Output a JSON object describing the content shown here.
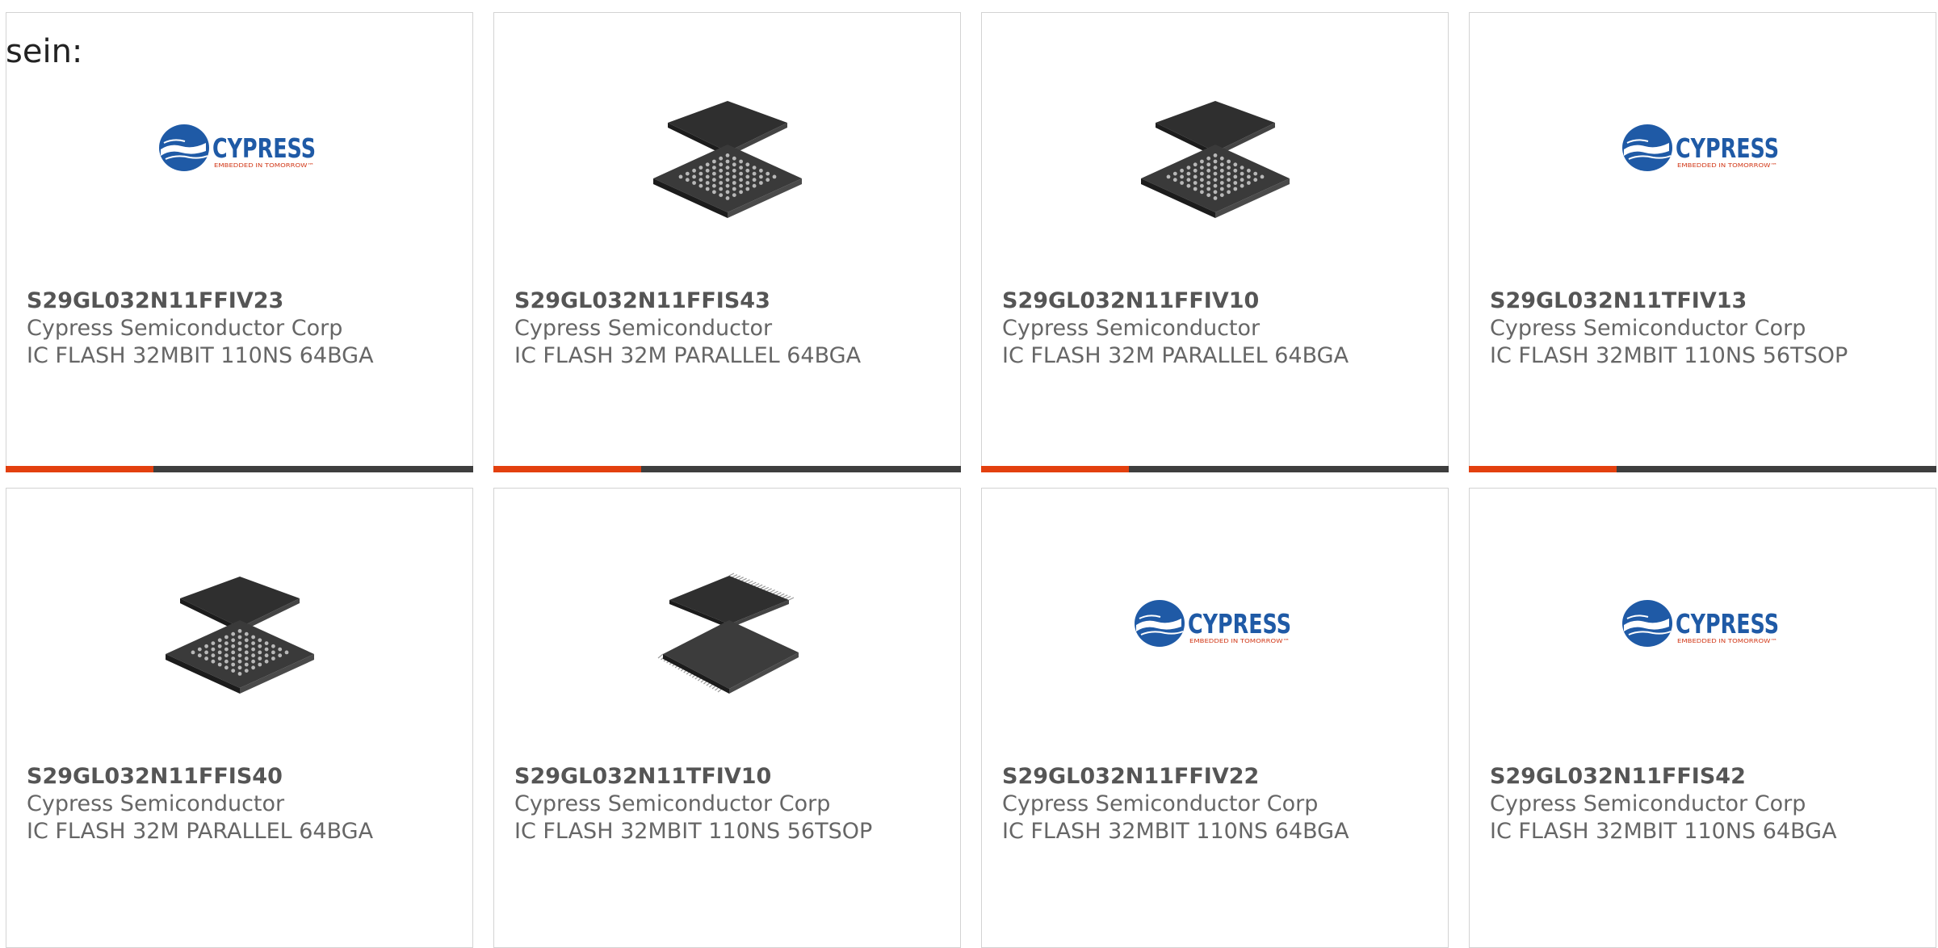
{
  "intro_text": "sein:",
  "colors": {
    "accent": "#e3400f",
    "bar": "#3e3e3e",
    "cypress_blue": "#1f5aa6"
  },
  "products": [
    {
      "part_number": "S29GL032N11FFIV23",
      "manufacturer": "Cypress Semiconductor Corp",
      "description": "IC FLASH 32MBIT 110NS 64BGA",
      "image": "cypress-logo",
      "has_bar": true
    },
    {
      "part_number": "S29GL032N11FFIS43",
      "manufacturer": "Cypress Semiconductor",
      "description": "IC FLASH 32M PARALLEL 64BGA",
      "image": "bga-chip",
      "has_bar": true
    },
    {
      "part_number": "S29GL032N11FFIV10",
      "manufacturer": "Cypress Semiconductor",
      "description": "IC FLASH 32M PARALLEL 64BGA",
      "image": "bga-chip",
      "has_bar": true
    },
    {
      "part_number": "S29GL032N11TFIV13",
      "manufacturer": "Cypress Semiconductor Corp",
      "description": "IC FLASH 32MBIT 110NS 56TSOP",
      "image": "cypress-logo",
      "has_bar": true
    },
    {
      "part_number": "S29GL032N11FFIS40",
      "manufacturer": "Cypress Semiconductor",
      "description": "IC FLASH 32M PARALLEL 64BGA",
      "image": "bga-chip",
      "has_bar": false
    },
    {
      "part_number": "S29GL032N11TFIV10",
      "manufacturer": "Cypress Semiconductor Corp",
      "description": "IC FLASH 32MBIT 110NS 56TSOP",
      "image": "tsop-chip",
      "has_bar": false
    },
    {
      "part_number": "S29GL032N11FFIV22",
      "manufacturer": "Cypress Semiconductor Corp",
      "description": "IC FLASH 32MBIT 110NS 64BGA",
      "image": "cypress-logo",
      "has_bar": false
    },
    {
      "part_number": "S29GL032N11FFIS42",
      "manufacturer": "Cypress Semiconductor Corp",
      "description": "IC FLASH 32MBIT 110NS 64BGA",
      "image": "cypress-logo",
      "has_bar": false
    }
  ]
}
